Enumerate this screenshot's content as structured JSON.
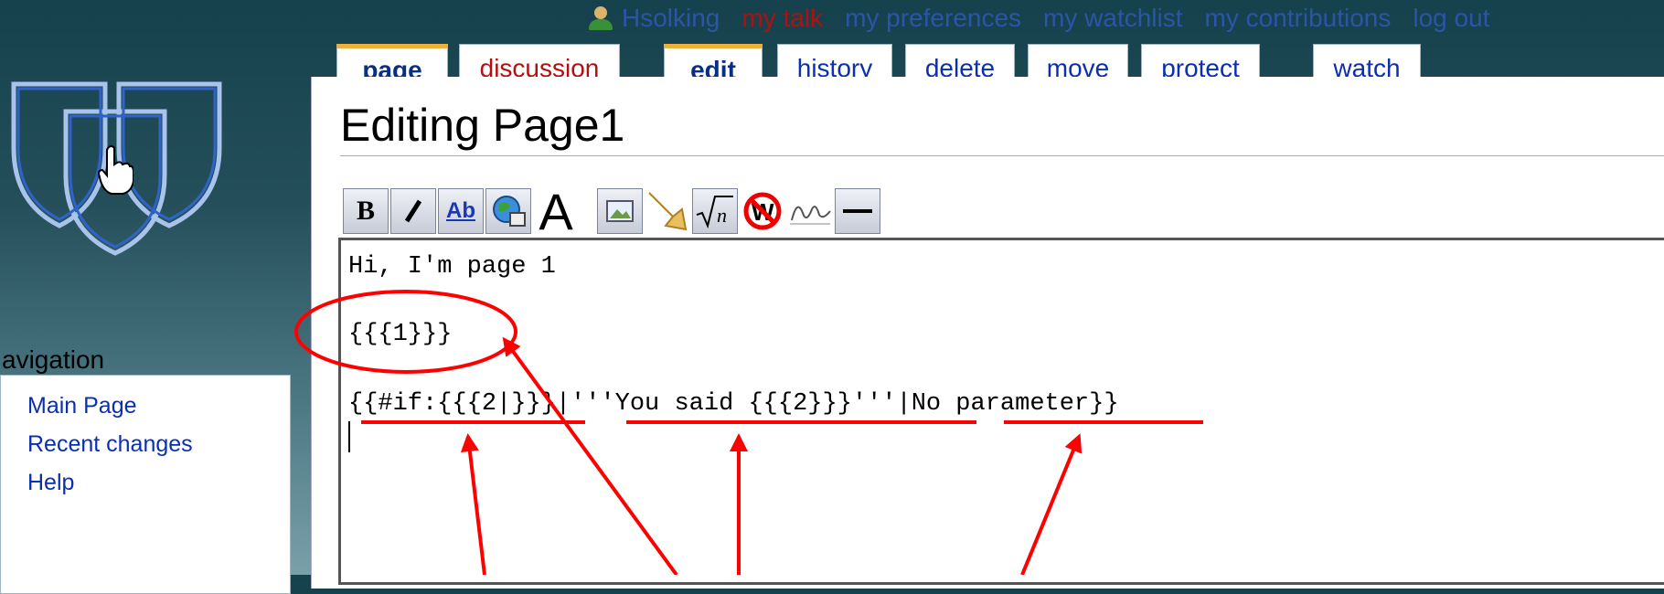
{
  "personal": {
    "username": "Hsolking",
    "talk": "my talk",
    "preferences": "my preferences",
    "watchlist": "my watchlist",
    "contributions": "my contributions",
    "logout": "log out"
  },
  "tabs": {
    "page": "page",
    "discussion": "discussion",
    "edit": "edit",
    "history": "history",
    "delete": "delete",
    "move": "move",
    "protect": "protect",
    "watch": "watch"
  },
  "title": "Editing Page1",
  "sidebar": {
    "heading": "avigation",
    "items": [
      "Main Page",
      "Recent changes",
      "Help"
    ]
  },
  "toolbar": {
    "bold": "B",
    "italic": "I",
    "internal_link": "Ab",
    "big_a": "A",
    "signature": "",
    "icons": [
      "bold-icon",
      "italic-icon",
      "internal-link-icon",
      "external-link-icon",
      "headline-icon",
      "image-icon",
      "media-icon",
      "math-icon",
      "nowiki-icon",
      "signature-icon",
      "horizontal-rule-icon"
    ]
  },
  "editor": {
    "lines": [
      "Hi, I'm page 1",
      "",
      "{{{1}}}",
      "",
      "{{#if:{{{2|}}}|'''You said {{{2}}}'''|No parameter}}"
    ]
  },
  "colors": {
    "annotation": "#ff0000",
    "link": "#0a2fb0",
    "selected_tab_border": "#f0b13a"
  }
}
